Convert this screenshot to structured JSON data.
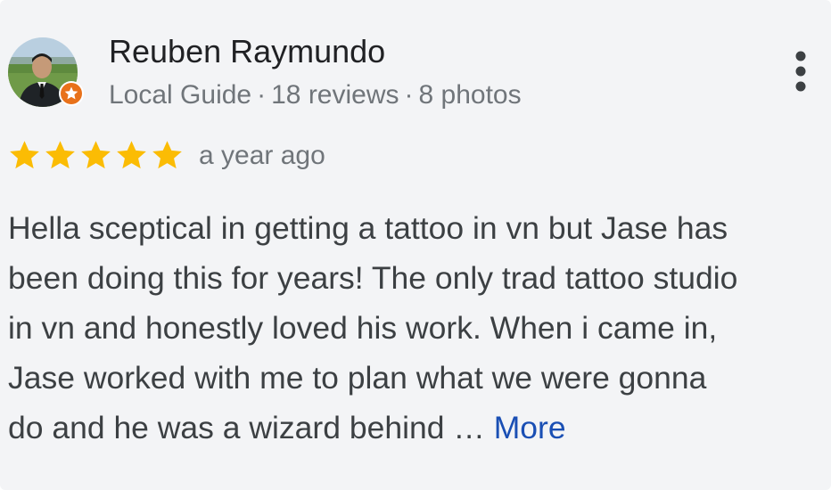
{
  "reviewer": {
    "name": "Reuben Raymundo",
    "badge": "Local Guide",
    "reviews": "18 reviews",
    "photos": "8 photos",
    "separator": "·",
    "badge_icon": "star-badge-icon",
    "badge_color": "#e8711a"
  },
  "rating": {
    "stars": 5,
    "max": 5,
    "star_color": "#fbbc04",
    "time": "a year ago"
  },
  "review": {
    "lines": [
      "Hella sceptical in getting a tattoo in vn but Jase has",
      "been doing this for years! The only trad tattoo studio",
      "in vn and honestly loved his work. When i came in,",
      "Jase worked with me to plan what we were gonna",
      "do and he was a wizard behind"
    ],
    "ellipsis": "…",
    "more_label": "More",
    "more_color": "#1a4fb4"
  },
  "menu": {
    "icon": "more-vert-icon"
  }
}
